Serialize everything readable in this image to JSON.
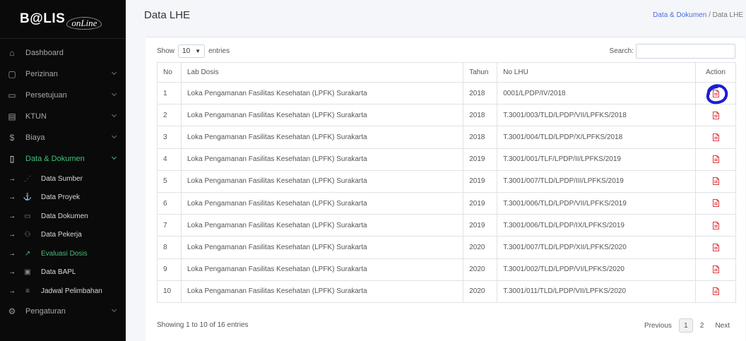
{
  "app": {
    "logo_main": "B@LIS",
    "logo_sub": "onLine"
  },
  "sidebar": {
    "items": [
      {
        "label": "Dashboard",
        "icon": "home-icon",
        "glyph": "⌂"
      },
      {
        "label": "Perizinan",
        "icon": "document-icon",
        "glyph": "▢"
      },
      {
        "label": "Persetujuan",
        "icon": "folder-icon",
        "glyph": "▭"
      },
      {
        "label": "KTUN",
        "icon": "card-icon",
        "glyph": "▤"
      },
      {
        "label": "Biaya",
        "icon": "dollar-icon",
        "glyph": "$"
      },
      {
        "label": "Data & Dokumen",
        "icon": "clipboard-icon",
        "glyph": "▯"
      },
      {
        "label": "Pengaturan",
        "icon": "gear-icon",
        "glyph": "⚙"
      }
    ],
    "subitems": [
      {
        "label": "Data Sumber",
        "icon": "rss-icon",
        "glyph": "⋰"
      },
      {
        "label": "Data Proyek",
        "icon": "anchor-icon",
        "glyph": "⚓"
      },
      {
        "label": "Data Dokumen",
        "icon": "folder-icon",
        "glyph": "▭"
      },
      {
        "label": "Data Pekerja",
        "icon": "users-icon",
        "glyph": "⚇"
      },
      {
        "label": "Evaluasi Dosis",
        "icon": "trend-icon",
        "glyph": "↗"
      },
      {
        "label": "Data BAPL",
        "icon": "calendar-icon",
        "glyph": "▣"
      },
      {
        "label": "Jadwal Pelimbahan",
        "icon": "list-icon",
        "glyph": "≡"
      }
    ],
    "arrow": "→",
    "active_item": "Data & Dokumen",
    "active_subitem": "Evaluasi Dosis"
  },
  "header": {
    "title": "Data LHE",
    "breadcrumb_link": "Data & Dokumen",
    "breadcrumb_sep": "/",
    "breadcrumb_current": "Data LHE"
  },
  "table_controls": {
    "show_label": "Show",
    "entries_value": "10",
    "entries_label": "entries",
    "search_label": "Search:",
    "search_value": ""
  },
  "table": {
    "columns": [
      "No",
      "Lab Dosis",
      "Tahun",
      "No LHU",
      "Action"
    ],
    "rows": [
      {
        "no": "1",
        "lab": "Loka Pengamanan Fasilitas Kesehatan (LPFK) Surakarta",
        "tahun": "2018",
        "lhu": "0001/LPDP/IV/2018"
      },
      {
        "no": "2",
        "lab": "Loka Pengamanan Fasilitas Kesehatan (LPFK) Surakarta",
        "tahun": "2018",
        "lhu": "T.3001/003/TLD/LPDP/VII/LPFKS/2018"
      },
      {
        "no": "3",
        "lab": "Loka Pengamanan Fasilitas Kesehatan (LPFK) Surakarta",
        "tahun": "2018",
        "lhu": "T.3001/004/TLD/LPDP/X/LPFKS/2018"
      },
      {
        "no": "4",
        "lab": "Loka Pengamanan Fasilitas Kesehatan (LPFK) Surakarta",
        "tahun": "2019",
        "lhu": "T.3001/001/TLF/LPDP/II/LPFKS/2019"
      },
      {
        "no": "5",
        "lab": "Loka Pengamanan Fasilitas Kesehatan (LPFK) Surakarta",
        "tahun": "2019",
        "lhu": "T.3001/007/TLD/LPDP/III/LPFKS/2019"
      },
      {
        "no": "6",
        "lab": "Loka Pengamanan Fasilitas Kesehatan (LPFK) Surakarta",
        "tahun": "2019",
        "lhu": "T.3001/006/TLD/LPDP/VII/LPFKS/2019"
      },
      {
        "no": "7",
        "lab": "Loka Pengamanan Fasilitas Kesehatan (LPFK) Surakarta",
        "tahun": "2019",
        "lhu": "T.3001/006/TLD/LPDP/IX/LPFKS/2019"
      },
      {
        "no": "8",
        "lab": "Loka Pengamanan Fasilitas Kesehatan (LPFK) Surakarta",
        "tahun": "2020",
        "lhu": "T.3001/007/TLD/LPDP/XII/LPFKS/2020"
      },
      {
        "no": "9",
        "lab": "Loka Pengamanan Fasilitas Kesehatan (LPFK) Surakarta",
        "tahun": "2020",
        "lhu": "T.3001/002/TLD/LPDP/VI/LPFKS/2020"
      },
      {
        "no": "10",
        "lab": "Loka Pengamanan Fasilitas Kesehatan (LPFK) Surakarta",
        "tahun": "2020",
        "lhu": "T.3001/011/TLD/LPDP/VII/LPFKS/2020"
      }
    ],
    "action_icon": "pdf-file-icon"
  },
  "footer": {
    "info": "Showing 1 to 10 of 16 entries",
    "previous": "Previous",
    "pages": [
      "1",
      "2"
    ],
    "next": "Next"
  },
  "colors": {
    "sidebar_bg": "#0a0a0a",
    "active_green": "#3ec07c",
    "link_blue": "#4a6fe3",
    "pdf_red": "#e0393e",
    "annotation_blue": "#1c1cd6"
  }
}
